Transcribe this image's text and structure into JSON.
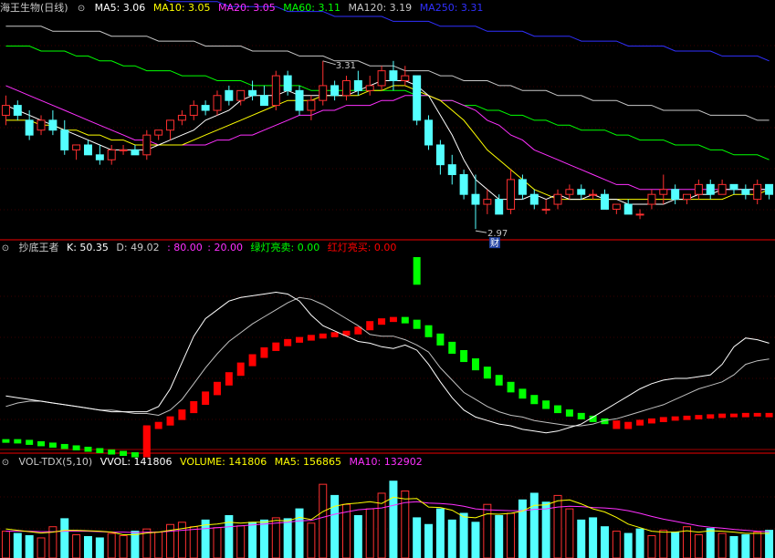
{
  "colors": {
    "bg": "#000000",
    "up": "#ff3030",
    "down": "#54ffff",
    "ma5": "#ffffff",
    "ma10": "#ffff00",
    "ma20": "#ff30ff",
    "ma60": "#00ff00",
    "ma120": "#c8c8c8",
    "ma250": "#3030ff",
    "grid": "#3a0000",
    "separator": "#a00000",
    "redlight": "#ff0000",
    "greenlight": "#00ff00",
    "k_line": "#ffffff",
    "d_line": "#c0c0c0"
  },
  "price_panel": {
    "title": "海王生物(日线)",
    "collapse_icon": "chevron-circle-icon",
    "ma5": "MA5: 3.06",
    "ma10": "MA10: 3.05",
    "ma20": "MA20: 3.05",
    "ma60": "MA60: 3.11",
    "ma120": "MA120: 3.19",
    "ma250": "MA250: 3.31",
    "high_annotation": "3.31",
    "low_annotation": "2.97",
    "badge": "财"
  },
  "kd_panel": {
    "title": "抄底王者",
    "k": "K: 50.35",
    "d": "D: 49.02",
    "l80": ": 80.00",
    "l20": ": 20.00",
    "green_buy": "绿灯亮卖: 0.00",
    "red_buy": "红灯亮买: 0.00"
  },
  "vol_panel": {
    "title": "VOL-TDX(5,10)",
    "vvol": "VVOL: 141806",
    "volume": "VOLUME: 141806",
    "ma5": "MA5: 156865",
    "ma10": "MA10: 132902"
  },
  "chart_data": {
    "type": "candlestick",
    "price_axis": [
      2.95,
      3.4
    ],
    "candles": [
      [
        3.2,
        3.24,
        3.18,
        3.22
      ],
      [
        3.22,
        3.23,
        3.19,
        3.2
      ],
      [
        3.19,
        3.21,
        3.15,
        3.16
      ],
      [
        3.17,
        3.2,
        3.16,
        3.19
      ],
      [
        3.19,
        3.21,
        3.16,
        3.17
      ],
      [
        3.17,
        3.19,
        3.12,
        3.13
      ],
      [
        3.13,
        3.14,
        3.11,
        3.14
      ],
      [
        3.14,
        3.15,
        3.12,
        3.12
      ],
      [
        3.12,
        3.14,
        3.1,
        3.11
      ],
      [
        3.11,
        3.14,
        3.1,
        3.13
      ],
      [
        3.13,
        3.14,
        3.12,
        3.13
      ],
      [
        3.13,
        3.14,
        3.12,
        3.12
      ],
      [
        3.12,
        3.17,
        3.11,
        3.16
      ],
      [
        3.16,
        3.17,
        3.15,
        3.17
      ],
      [
        3.17,
        3.19,
        3.15,
        3.19
      ],
      [
        3.19,
        3.21,
        3.18,
        3.2
      ],
      [
        3.2,
        3.23,
        3.19,
        3.22
      ],
      [
        3.22,
        3.23,
        3.2,
        3.21
      ],
      [
        3.21,
        3.25,
        3.2,
        3.24
      ],
      [
        3.25,
        3.26,
        3.22,
        3.23
      ],
      [
        3.23,
        3.25,
        3.22,
        3.25
      ],
      [
        3.25,
        3.27,
        3.23,
        3.24
      ],
      [
        3.24,
        3.26,
        3.22,
        3.22
      ],
      [
        3.22,
        3.29,
        3.21,
        3.28
      ],
      [
        3.28,
        3.29,
        3.24,
        3.25
      ],
      [
        3.25,
        3.26,
        3.2,
        3.21
      ],
      [
        3.21,
        3.24,
        3.19,
        3.23
      ],
      [
        3.23,
        3.31,
        3.22,
        3.26
      ],
      [
        3.26,
        3.27,
        3.23,
        3.24
      ],
      [
        3.24,
        3.28,
        3.23,
        3.27
      ],
      [
        3.27,
        3.29,
        3.24,
        3.25
      ],
      [
        3.25,
        3.28,
        3.24,
        3.26
      ],
      [
        3.26,
        3.3,
        3.25,
        3.29
      ],
      [
        3.29,
        3.31,
        3.25,
        3.27
      ],
      [
        3.27,
        3.3,
        3.26,
        3.28
      ],
      [
        3.28,
        3.28,
        3.18,
        3.19
      ],
      [
        3.19,
        3.2,
        3.13,
        3.14
      ],
      [
        3.14,
        3.15,
        3.08,
        3.1
      ],
      [
        3.1,
        3.12,
        3.06,
        3.08
      ],
      [
        3.08,
        3.09,
        3.03,
        3.04
      ],
      [
        3.04,
        3.08,
        2.97,
        3.02
      ],
      [
        3.02,
        3.05,
        3.0,
        3.03
      ],
      [
        3.03,
        3.04,
        3.0,
        3.0
      ],
      [
        3.01,
        3.09,
        3.0,
        3.07
      ],
      [
        3.07,
        3.08,
        3.03,
        3.04
      ],
      [
        3.04,
        3.05,
        3.01,
        3.02
      ],
      [
        3.01,
        3.03,
        3.0,
        3.01
      ],
      [
        3.02,
        3.05,
        3.01,
        3.04
      ],
      [
        3.04,
        3.06,
        3.03,
        3.05
      ],
      [
        3.05,
        3.06,
        3.03,
        3.04
      ],
      [
        3.04,
        3.05,
        3.03,
        3.04
      ],
      [
        3.04,
        3.05,
        3.01,
        3.01
      ],
      [
        3.01,
        3.02,
        3.0,
        3.02
      ],
      [
        3.02,
        3.03,
        3.0,
        3.0
      ],
      [
        3.0,
        3.01,
        2.99,
        3.0
      ],
      [
        3.02,
        3.05,
        3.01,
        3.04
      ],
      [
        3.04,
        3.08,
        3.02,
        3.05
      ],
      [
        3.05,
        3.06,
        3.02,
        3.03
      ],
      [
        3.03,
        3.04,
        3.02,
        3.04
      ],
      [
        3.04,
        3.07,
        3.03,
        3.06
      ],
      [
        3.06,
        3.07,
        3.03,
        3.04
      ],
      [
        3.04,
        3.07,
        3.04,
        3.06
      ],
      [
        3.06,
        3.06,
        3.04,
        3.05
      ],
      [
        3.05,
        3.06,
        3.03,
        3.04
      ],
      [
        3.03,
        3.07,
        3.02,
        3.06
      ],
      [
        3.06,
        3.06,
        3.03,
        3.04
      ]
    ],
    "ma5": [
      3.22,
      3.21,
      3.2,
      3.19,
      3.18,
      3.17,
      3.16,
      3.15,
      3.14,
      3.13,
      3.13,
      3.13,
      3.13,
      3.14,
      3.15,
      3.16,
      3.17,
      3.19,
      3.2,
      3.21,
      3.23,
      3.24,
      3.24,
      3.24,
      3.25,
      3.24,
      3.24,
      3.24,
      3.24,
      3.24,
      3.25,
      3.26,
      3.27,
      3.27,
      3.27,
      3.26,
      3.24,
      3.2,
      3.16,
      3.11,
      3.07,
      3.05,
      3.03,
      3.03,
      3.03,
      3.04,
      3.03,
      3.04,
      3.03,
      3.03,
      3.04,
      3.03,
      3.03,
      3.02,
      3.02,
      3.02,
      3.02,
      3.03,
      3.03,
      3.04,
      3.04,
      3.05,
      3.05,
      3.05,
      3.05,
      3.05
    ],
    "ma10": [
      3.19,
      3.19,
      3.19,
      3.18,
      3.18,
      3.17,
      3.17,
      3.16,
      3.16,
      3.15,
      3.15,
      3.14,
      3.14,
      3.14,
      3.14,
      3.14,
      3.15,
      3.16,
      3.17,
      3.18,
      3.19,
      3.2,
      3.21,
      3.22,
      3.23,
      3.23,
      3.23,
      3.24,
      3.24,
      3.24,
      3.24,
      3.25,
      3.25,
      3.26,
      3.26,
      3.25,
      3.24,
      3.23,
      3.21,
      3.19,
      3.16,
      3.13,
      3.11,
      3.09,
      3.07,
      3.05,
      3.04,
      3.03,
      3.03,
      3.03,
      3.03,
      3.03,
      3.03,
      3.03,
      3.03,
      3.03,
      3.03,
      3.03,
      3.03,
      3.03,
      3.03,
      3.03,
      3.04,
      3.04,
      3.04,
      3.05
    ],
    "ma20": [
      3.26,
      3.25,
      3.24,
      3.23,
      3.22,
      3.21,
      3.2,
      3.19,
      3.18,
      3.17,
      3.16,
      3.15,
      3.15,
      3.14,
      3.14,
      3.14,
      3.14,
      3.14,
      3.15,
      3.15,
      3.16,
      3.16,
      3.17,
      3.18,
      3.19,
      3.2,
      3.2,
      3.21,
      3.21,
      3.22,
      3.22,
      3.22,
      3.23,
      3.23,
      3.24,
      3.24,
      3.24,
      3.23,
      3.23,
      3.22,
      3.21,
      3.19,
      3.18,
      3.16,
      3.15,
      3.13,
      3.12,
      3.11,
      3.1,
      3.09,
      3.08,
      3.07,
      3.06,
      3.06,
      3.05,
      3.05,
      3.05,
      3.05,
      3.05,
      3.05,
      3.05,
      3.05,
      3.05,
      3.05,
      3.05,
      3.05
    ],
    "ma60": [
      3.34,
      3.34,
      3.34,
      3.33,
      3.33,
      3.33,
      3.32,
      3.32,
      3.31,
      3.31,
      3.3,
      3.3,
      3.29,
      3.29,
      3.29,
      3.28,
      3.28,
      3.28,
      3.27,
      3.27,
      3.27,
      3.26,
      3.26,
      3.26,
      3.26,
      3.26,
      3.25,
      3.25,
      3.25,
      3.25,
      3.25,
      3.25,
      3.25,
      3.25,
      3.25,
      3.24,
      3.24,
      3.23,
      3.23,
      3.22,
      3.22,
      3.21,
      3.21,
      3.2,
      3.2,
      3.19,
      3.19,
      3.18,
      3.18,
      3.17,
      3.17,
      3.17,
      3.16,
      3.16,
      3.15,
      3.15,
      3.15,
      3.14,
      3.14,
      3.14,
      3.13,
      3.13,
      3.12,
      3.12,
      3.12,
      3.11
    ],
    "ma120": [
      3.38,
      3.38,
      3.38,
      3.38,
      3.37,
      3.37,
      3.37,
      3.37,
      3.37,
      3.36,
      3.36,
      3.36,
      3.36,
      3.35,
      3.35,
      3.35,
      3.35,
      3.34,
      3.34,
      3.34,
      3.34,
      3.33,
      3.33,
      3.33,
      3.33,
      3.32,
      3.32,
      3.32,
      3.31,
      3.31,
      3.31,
      3.3,
      3.3,
      3.3,
      3.29,
      3.29,
      3.29,
      3.28,
      3.28,
      3.27,
      3.27,
      3.27,
      3.26,
      3.26,
      3.25,
      3.25,
      3.25,
      3.24,
      3.24,
      3.24,
      3.23,
      3.23,
      3.23,
      3.22,
      3.22,
      3.22,
      3.21,
      3.21,
      3.21,
      3.21,
      3.2,
      3.2,
      3.2,
      3.2,
      3.19,
      3.19
    ],
    "ma250": [
      3.46,
      3.46,
      3.46,
      3.46,
      3.45,
      3.45,
      3.45,
      3.45,
      3.45,
      3.44,
      3.44,
      3.44,
      3.44,
      3.44,
      3.43,
      3.43,
      3.43,
      3.43,
      3.43,
      3.42,
      3.42,
      3.42,
      3.42,
      3.42,
      3.41,
      3.41,
      3.41,
      3.41,
      3.4,
      3.4,
      3.4,
      3.4,
      3.4,
      3.39,
      3.39,
      3.39,
      3.39,
      3.38,
      3.38,
      3.38,
      3.38,
      3.37,
      3.37,
      3.37,
      3.37,
      3.36,
      3.36,
      3.36,
      3.36,
      3.35,
      3.35,
      3.35,
      3.35,
      3.34,
      3.34,
      3.34,
      3.34,
      3.33,
      3.33,
      3.33,
      3.33,
      3.32,
      3.32,
      3.32,
      3.32,
      3.31
    ],
    "kd_axis": [
      -5,
      105
    ],
    "k": [
      26,
      25,
      24,
      23,
      22,
      21,
      20,
      19,
      18,
      17,
      17,
      17,
      17,
      20,
      30,
      45,
      60,
      70,
      75,
      80,
      82,
      83,
      84,
      85,
      84,
      80,
      72,
      66,
      63,
      60,
      57,
      56,
      54,
      53,
      55,
      52,
      44,
      34,
      25,
      18,
      14,
      12,
      10,
      9,
      7,
      6,
      5,
      6,
      8,
      10,
      14,
      18,
      22,
      26,
      30,
      33,
      35,
      36,
      36,
      37,
      38,
      44,
      54,
      59,
      58,
      56
    ],
    "d": [
      20,
      22,
      23,
      23,
      22,
      21,
      20,
      19,
      18,
      18,
      17,
      16,
      16,
      15,
      18,
      24,
      33,
      42,
      50,
      57,
      62,
      67,
      71,
      75,
      79,
      82,
      81,
      78,
      74,
      70,
      66,
      61,
      60,
      60,
      58,
      55,
      51,
      42,
      35,
      28,
      24,
      20,
      17,
      15,
      14,
      12,
      11,
      10,
      9,
      9,
      10,
      12,
      13,
      15,
      17,
      19,
      21,
      24,
      27,
      30,
      32,
      34,
      38,
      44,
      46,
      47
    ],
    "signal_axis": [
      -3,
      25
    ],
    "signal": [
      -1.5,
      -1.6,
      -1.8,
      -2.0,
      -2.2,
      -2.4,
      -2.6,
      -2.8,
      -3.0,
      -3.2,
      -3.4,
      -3.6,
      0.5,
      1.0,
      1.8,
      2.8,
      4.0,
      5.4,
      6.8,
      8.2,
      9.6,
      10.8,
      11.8,
      12.5,
      13.0,
      13.3,
      13.6,
      13.8,
      14.0,
      14.2,
      14.8,
      15.6,
      16.0,
      16.2,
      15.8,
      15.0,
      13.8,
      12.6,
      11.4,
      10.2,
      9.0,
      7.8,
      6.8,
      5.8,
      4.9,
      4.1,
      3.4,
      2.8,
      2.3,
      1.9,
      1.5,
      1.2,
      0.5,
      1.0,
      1.3,
      1.5,
      1.7,
      1.8,
      1.9,
      2.0,
      2.1,
      2.2,
      2.2,
      2.3,
      2.3,
      2.2
    ],
    "signal_colors": [
      "g",
      "g",
      "g",
      "g",
      "g",
      "g",
      "g",
      "g",
      "g",
      "g",
      "g",
      "g",
      "r",
      "r",
      "r",
      "r",
      "r",
      "r",
      "r",
      "r",
      "r",
      "r",
      "r",
      "r",
      "r",
      "r",
      "r",
      "r",
      "r",
      "r",
      "r",
      "r",
      "r",
      "r",
      "g",
      "g",
      "g",
      "g",
      "g",
      "g",
      "g",
      "g",
      "g",
      "g",
      "g",
      "g",
      "g",
      "g",
      "g",
      "g",
      "g",
      "g",
      "r",
      "r",
      "r",
      "r",
      "r",
      "r",
      "r",
      "r",
      "r",
      "r",
      "r",
      "r",
      "r",
      "r"
    ],
    "extra_green_bar": {
      "index": 35,
      "range": [
        21,
        25
      ]
    },
    "vol_axis": [
      0,
      200000
    ],
    "volume": [
      60000,
      55000,
      50000,
      45000,
      70000,
      88000,
      52000,
      48000,
      45000,
      55000,
      50000,
      60000,
      65000,
      58000,
      75000,
      80000,
      70000,
      85000,
      68000,
      95000,
      72000,
      80000,
      85000,
      90000,
      88000,
      110000,
      78000,
      165000,
      140000,
      120000,
      95000,
      110000,
      145000,
      172000,
      150000,
      90000,
      75000,
      110000,
      85000,
      100000,
      80000,
      120000,
      95000,
      100000,
      130000,
      145000,
      125000,
      140000,
      110000,
      85000,
      90000,
      70000,
      60000,
      55000,
      65000,
      50000,
      62000,
      58000,
      70000,
      52000,
      66000,
      55000,
      48000,
      52000,
      58000,
      62000
    ],
    "vol_ma5": [
      65000,
      62000,
      59000,
      56000,
      58000,
      62000,
      62000,
      61000,
      60000,
      58000,
      52000,
      52000,
      56000,
      58000,
      62000,
      66000,
      70000,
      74000,
      76000,
      80000,
      78000,
      80000,
      80000,
      84000,
      83000,
      91000,
      86000,
      104000,
      116000,
      121000,
      123000,
      126000,
      122000,
      136000,
      132000,
      133000,
      114000,
      113000,
      107000,
      92000,
      90000,
      99000,
      98000,
      100000,
      105000,
      118000,
      119000,
      128000,
      130000,
      121000,
      110000,
      103000,
      91000,
      76000,
      68000,
      60000,
      58000,
      58000,
      61000,
      58000,
      61000,
      60000,
      58000,
      55000,
      55000,
      55000
    ],
    "vol_ma10": [
      60000,
      60000,
      60000,
      59000,
      59000,
      60000,
      60000,
      60000,
      59000,
      58000,
      58000,
      57000,
      58000,
      58000,
      60000,
      62000,
      64000,
      66000,
      68000,
      70000,
      72000,
      74000,
      76000,
      78000,
      80000,
      83000,
      84000,
      91000,
      98000,
      103000,
      108000,
      110000,
      112000,
      118000,
      124000,
      126000,
      123000,
      122000,
      120000,
      116000,
      110000,
      108000,
      107000,
      106000,
      106000,
      109000,
      110000,
      114000,
      116000,
      115000,
      113000,
      112000,
      110000,
      106000,
      100000,
      93000,
      87000,
      82000,
      77000,
      72000,
      69000,
      67000,
      64000,
      62000,
      60000,
      59000
    ],
    "vol_up": [
      1,
      0,
      0,
      1,
      1,
      0,
      1,
      0,
      0,
      1,
      1,
      0,
      1,
      1,
      1,
      1,
      1,
      0,
      1,
      0,
      1,
      0,
      0,
      1,
      0,
      0,
      1,
      1,
      0,
      1,
      0,
      1,
      1,
      0,
      1,
      0,
      0,
      0,
      0,
      0,
      0,
      1,
      0,
      1,
      0,
      0,
      0,
      1,
      1,
      0,
      0,
      0,
      1,
      0,
      0,
      1,
      1,
      0,
      1,
      1,
      0,
      1,
      0,
      0,
      1,
      0
    ]
  }
}
